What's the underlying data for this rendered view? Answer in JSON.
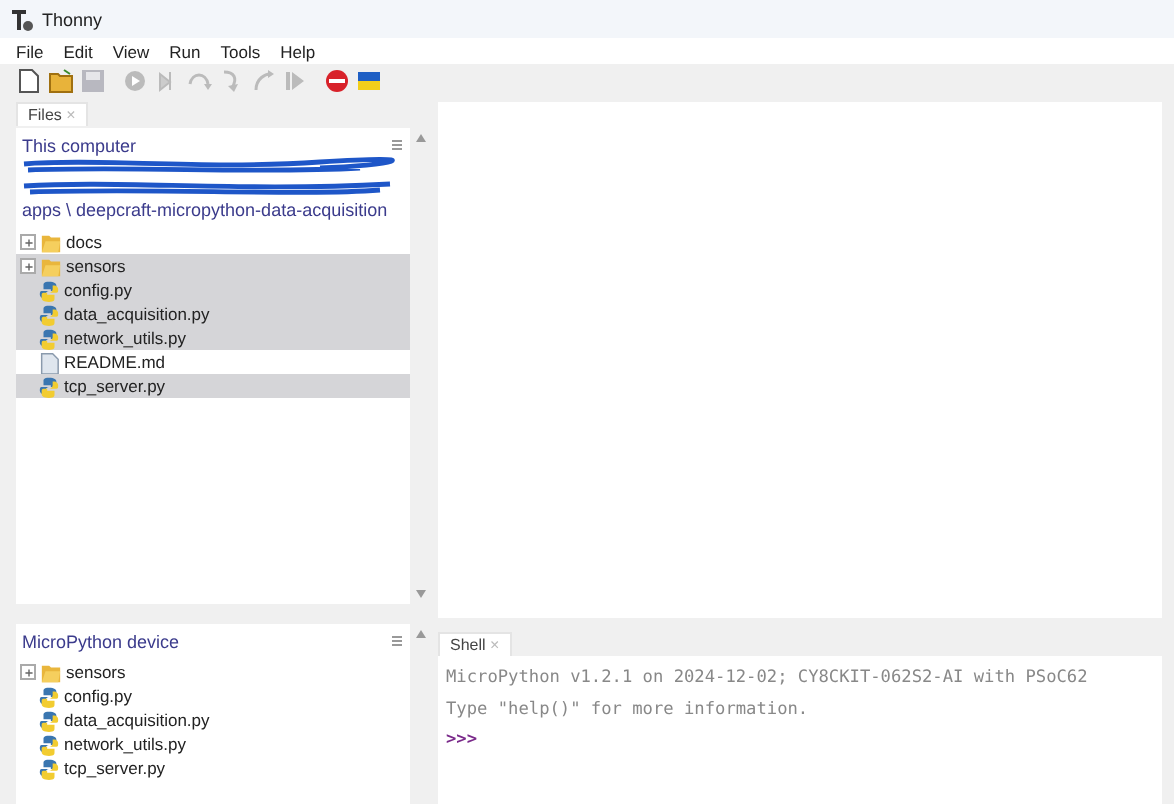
{
  "window": {
    "title": "Thonny"
  },
  "menu": [
    "File",
    "Edit",
    "View",
    "Run",
    "Tools",
    "Help"
  ],
  "files_panel": {
    "tab": {
      "label": "Files",
      "close": "×"
    },
    "location_title": "This computer",
    "path_last_line": "apps \\ deepcraft-micropython-data-acquisition",
    "items": [
      {
        "name": "docs",
        "kind": "folder",
        "selected": false
      },
      {
        "name": "sensors",
        "kind": "folder",
        "selected": true
      },
      {
        "name": "config.py",
        "kind": "python",
        "selected": true
      },
      {
        "name": "data_acquisition.py",
        "kind": "python",
        "selected": true
      },
      {
        "name": "network_utils.py",
        "kind": "python",
        "selected": true
      },
      {
        "name": "README.md",
        "kind": "text",
        "selected": false
      },
      {
        "name": "tcp_server.py",
        "kind": "python",
        "selected": true
      }
    ]
  },
  "device_panel": {
    "title": "MicroPython device",
    "items": [
      {
        "name": "sensors",
        "kind": "folder"
      },
      {
        "name": "config.py",
        "kind": "python"
      },
      {
        "name": "data_acquisition.py",
        "kind": "python"
      },
      {
        "name": "network_utils.py",
        "kind": "python"
      },
      {
        "name": "tcp_server.py",
        "kind": "python"
      }
    ]
  },
  "shell": {
    "tab": {
      "label": "Shell",
      "close": "×"
    },
    "lines": [
      "MicroPython v1.2.1 on 2024-12-02; CY8CKIT-062S2-AI with PSoC62",
      "Type \"help()\" for more information."
    ],
    "prompt": ">>>"
  }
}
